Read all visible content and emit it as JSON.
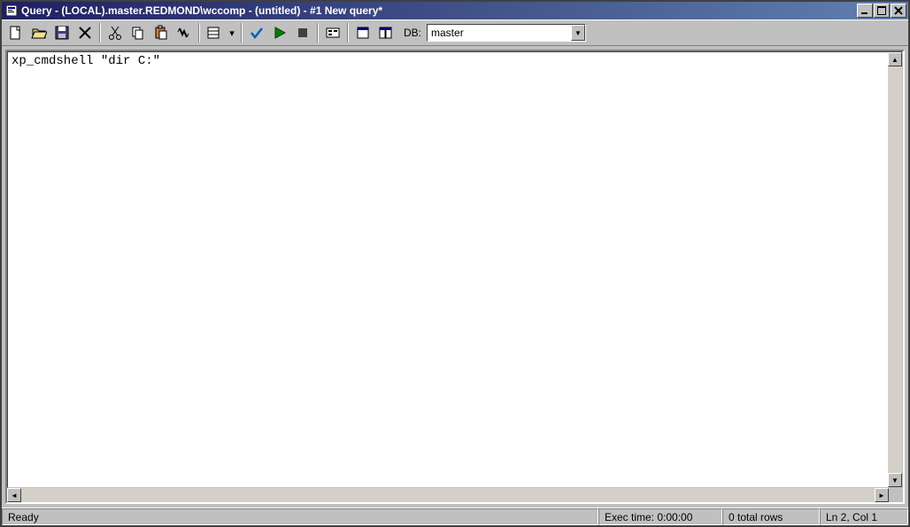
{
  "window": {
    "title": "Query - (LOCAL).master.REDMOND\\wccomp - (untitled) - #1 New query*"
  },
  "toolbar": {
    "db_label": "DB:",
    "db_selected": "master"
  },
  "editor": {
    "content": "xp_cmdshell \"dir C:\""
  },
  "status": {
    "ready": "Ready",
    "exec_time": "Exec time: 0:00:00",
    "rows": "0 total rows",
    "position": "Ln 2, Col 1"
  }
}
